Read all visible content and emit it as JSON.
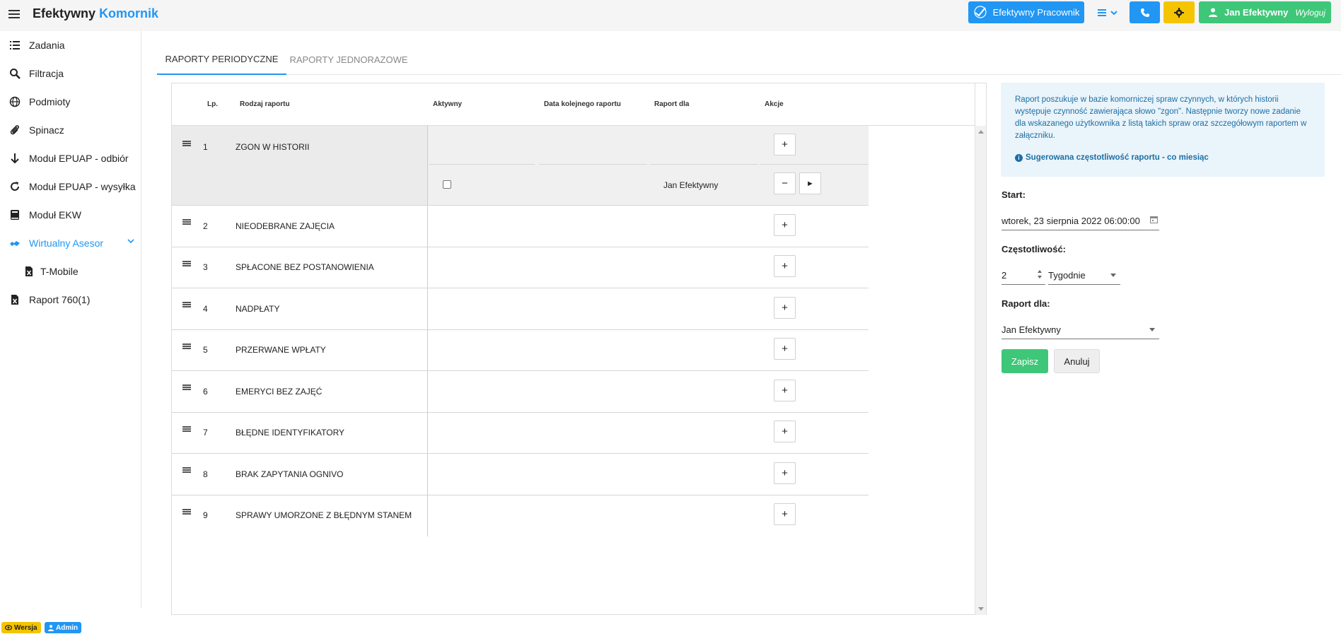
{
  "app": {
    "title_main": "Efektywny",
    "title_accent": "Komornik"
  },
  "topbar": {
    "pracownik_label": "Efektywny Pracownik",
    "user_name": "Jan Efektywny",
    "logout_label": "Wyloguj"
  },
  "sidebar": {
    "items": [
      {
        "label": "Zadania",
        "icon": "list-icon"
      },
      {
        "label": "Filtracja",
        "icon": "search-icon"
      },
      {
        "label": "Podmioty",
        "icon": "globe-icon"
      },
      {
        "label": "Spinacz",
        "icon": "paperclip-icon"
      },
      {
        "label": "Moduł EPUAP - odbiór",
        "icon": "arrow-down-icon"
      },
      {
        "label": "Moduł EPUAP - wysyłka",
        "icon": "redo-icon"
      },
      {
        "label": "Moduł EKW",
        "icon": "book-icon"
      },
      {
        "label": "Wirtualny Asesor",
        "icon": "handshake-icon"
      },
      {
        "label": "T-Mobile",
        "icon": "excel-file-icon"
      },
      {
        "label": "Raport 760(1)",
        "icon": "excel-file-icon"
      }
    ]
  },
  "tabs": [
    {
      "label": "RAPORTY PERIODYCZNE"
    },
    {
      "label": "RAPORTY JEDNORAZOWE"
    }
  ],
  "table": {
    "headers": {
      "lp": "Lp.",
      "type": "Rodzaj raportu",
      "active": "Aktywny",
      "next_date": "Data kolejnego raportu",
      "for": "Raport dla",
      "actions": "Akcje"
    },
    "rows": [
      {
        "lp": "1",
        "name": "ZGON W HISTORII"
      },
      {
        "lp": "2",
        "name": "NIEODEBRANE ZAJĘCIA"
      },
      {
        "lp": "3",
        "name": "SPŁACONE BEZ POSTANOWIENIA"
      },
      {
        "lp": "4",
        "name": "NADPŁATY"
      },
      {
        "lp": "5",
        "name": "PRZERWANE WPŁATY"
      },
      {
        "lp": "6",
        "name": "EMERYCI BEZ ZAJĘĆ"
      },
      {
        "lp": "7",
        "name": "BŁĘDNE IDENTYFIKATORY"
      },
      {
        "lp": "8",
        "name": "BRAK ZAPYTANIA OGNIVO"
      },
      {
        "lp": "9",
        "name": "SPRAWY UMORZONE Z BŁĘDNYM STANEM"
      }
    ],
    "expanded": {
      "report_for": "Jan Efektywny",
      "plus": "+",
      "minus": "−",
      "play": "►"
    }
  },
  "info": {
    "description": "Raport poszukuje w bazie komorniczej spraw czynnych, w których historii występuje czynność zawierająca słowo \"zgon\". Następnie tworzy nowe zadanie dla wskazanego użytkownika z listą takich spraw oraz szczegółowym raportem w załączniku.",
    "hint": "Sugerowana częstotliwość raportu - co miesiąc"
  },
  "form": {
    "start_label": "Start:",
    "start_value": "wtorek, 23 sierpnia 2022 06:00:00",
    "freq_label": "Częstotliwość:",
    "freq_number": "2",
    "freq_unit": "Tygodnie",
    "for_label": "Raport dla:",
    "for_value": "Jan Efektywny",
    "save": "Zapisz",
    "cancel": "Anuluj"
  },
  "badges": {
    "version": "Wersja",
    "admin": "Admin"
  },
  "colors": {
    "accent": "#2196f3",
    "success": "#3ec778",
    "warning": "#f5c400"
  }
}
